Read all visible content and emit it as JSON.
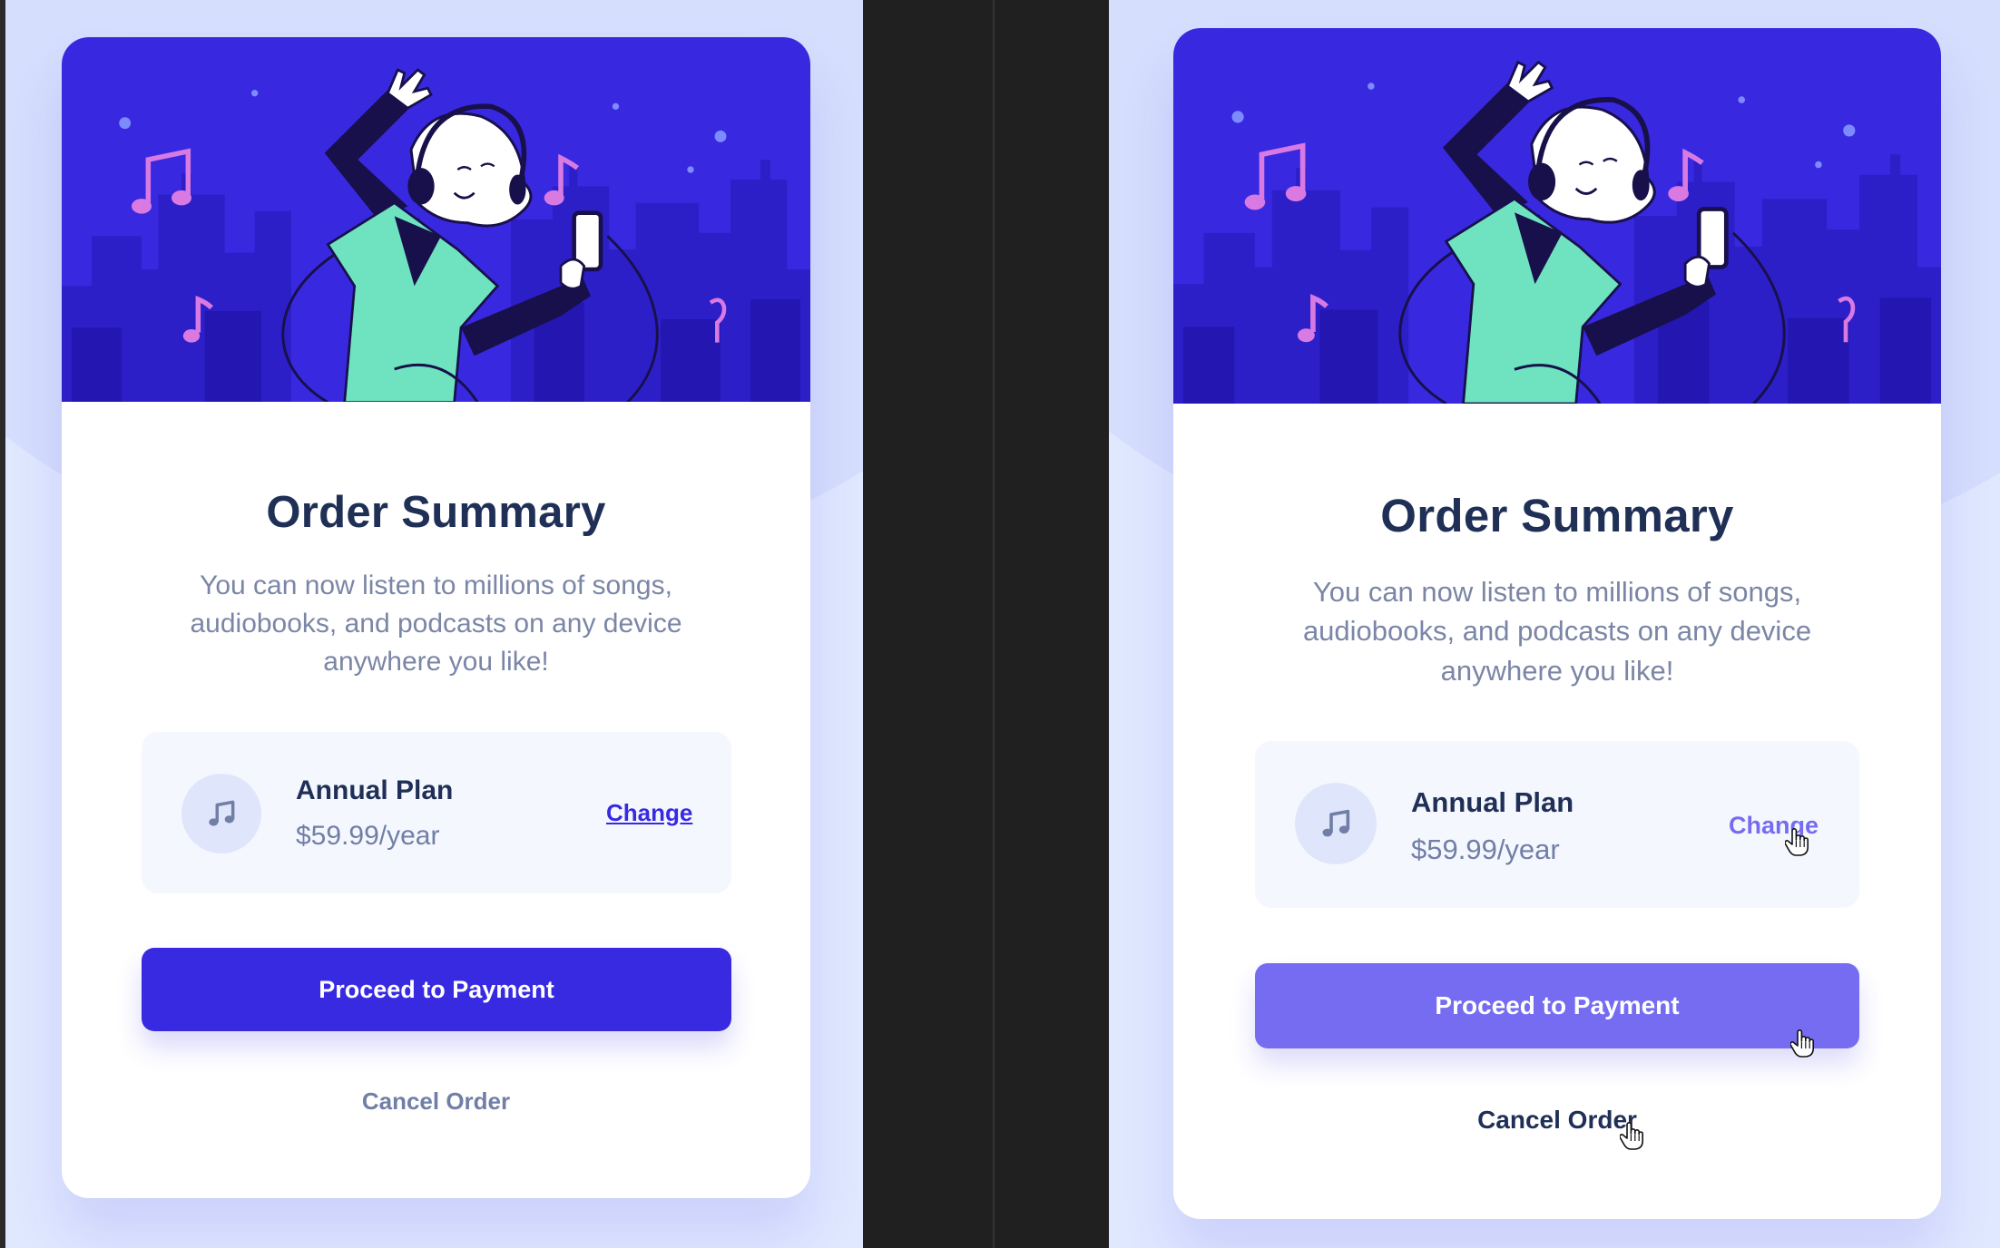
{
  "views": [
    {
      "title": "Order Summary",
      "description": "You can now listen to millions of songs, audiobooks, and podcasts on any device anywhere you like!",
      "plan": {
        "name": "Annual Plan",
        "price": "$59.99/year",
        "change_label": "Change",
        "icon": "music-note-icon"
      },
      "primary_button": "Proceed to Payment",
      "cancel_label": "Cancel Order",
      "state": "default"
    },
    {
      "title": "Order Summary",
      "description": "You can now listen to millions of songs, audiobooks, and podcasts on any device anywhere you like!",
      "plan": {
        "name": "Annual Plan",
        "price": "$59.99/year",
        "change_label": "Change",
        "icon": "music-note-icon"
      },
      "primary_button": "Proceed to Payment",
      "cancel_label": "Cancel Order",
      "state": "hover"
    }
  ],
  "colors": {
    "page_bg": "#e0e8ff",
    "hero_bg": "#3829e0",
    "primary": "#382ae1",
    "primary_hover": "#766cf1",
    "title": "#1f2f56",
    "muted": "#717fa6",
    "accent_green": "#6fe3c0",
    "accent_pink": "#d97ae3"
  }
}
